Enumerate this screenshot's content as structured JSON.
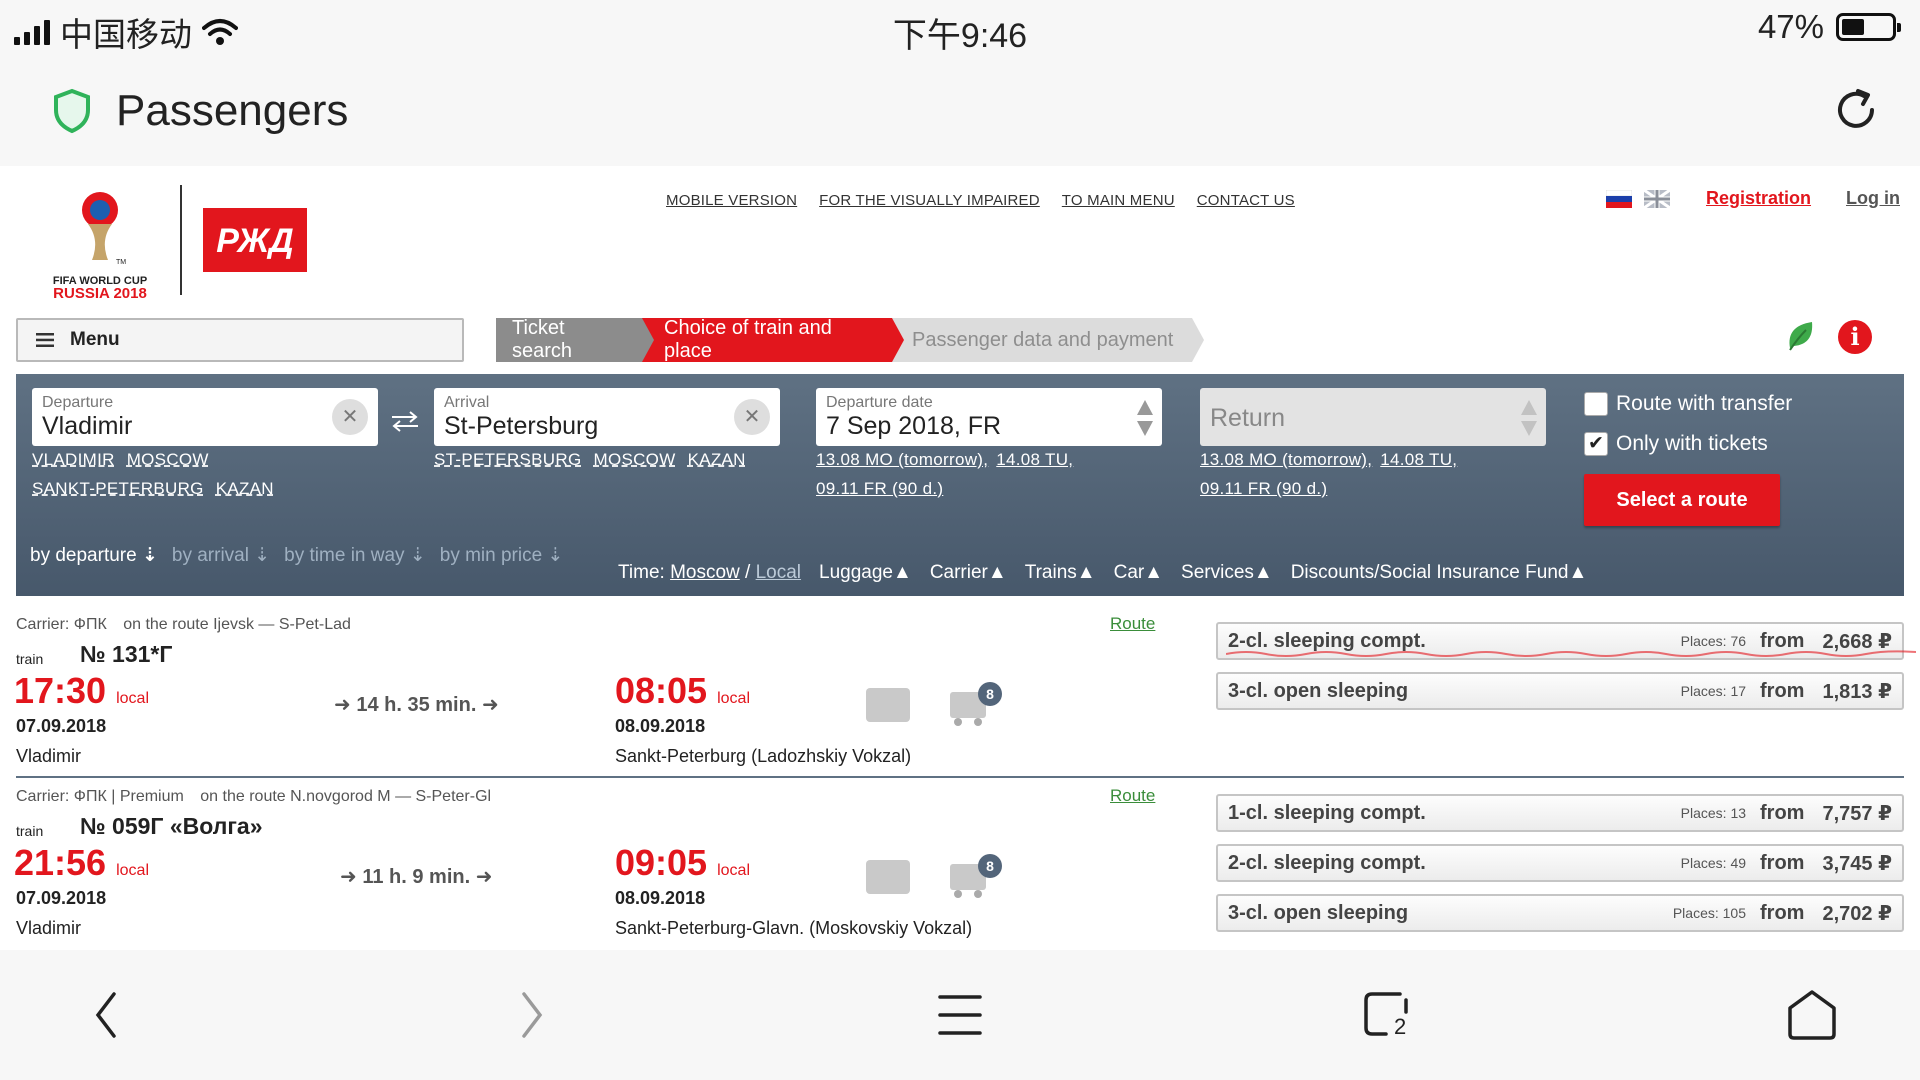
{
  "status_bar": {
    "carrier": "中国移动",
    "time": "下午9:46",
    "battery": "47%"
  },
  "app_header": {
    "title": "Passengers"
  },
  "site": {
    "top_links": [
      "MOBILE VERSION",
      "FOR THE VISUALLY IMPAIRED",
      "TO MAIN MENU",
      "CONTACT US"
    ],
    "registration": "Registration",
    "login": "Log in",
    "logo_text": {
      "line1": "FIFA WORLD CUP",
      "line2": "RUSSIA 2018",
      "tm": "TM",
      "rzd": "РЖД"
    }
  },
  "menu_label": "Menu",
  "steps": [
    "Ticket search",
    "Choice of train and place",
    "Passenger data and payment"
  ],
  "search": {
    "departure": {
      "label": "Departure",
      "value": "Vladimir",
      "suggestions": [
        "VLADIMIR",
        "MOSCOW",
        "SANKT-PETERBURG",
        "KAZAN"
      ]
    },
    "arrival": {
      "label": "Arrival",
      "value": "St-Petersburg",
      "suggestions": [
        "ST-PETERSBURG",
        "MOSCOW",
        "KAZAN"
      ]
    },
    "departure_date": {
      "label": "Departure date",
      "value": "7 Sep 2018, FR",
      "quick1": "13.08 MO (tomorrow),",
      "quick2": "14.08 TU,",
      "quick3": "09.11 FR (90 d.)"
    },
    "return": {
      "placeholder": "Return",
      "quick1": "13.08 MO (tomorrow),",
      "quick2": "14.08 TU,",
      "quick3": "09.11 FR (90 d.)"
    },
    "route_with_transfer": {
      "label": "Route with transfer",
      "checked": false
    },
    "only_with_tickets": {
      "label": "Only with tickets",
      "checked": true
    },
    "select_button": "Select a route"
  },
  "sorting": [
    "by departure",
    "by arrival",
    "by time in way",
    "by min price"
  ],
  "filters": {
    "time_label": "Time:",
    "time_moscow": "Moscow",
    "time_sep": "/",
    "time_local": "Local",
    "items": [
      "Luggage",
      "Carrier",
      "Trains",
      "Car",
      "Services",
      "Discounts/Social Insurance Fund"
    ]
  },
  "trains": [
    {
      "carrier": "Carrier: ФПК",
      "route_info": "on the route Ijevsk — S-Pet-Lad",
      "route_link": "Route",
      "train_label": "train",
      "number": "№ 131*Г",
      "dep_time": "17:30",
      "dep_suffix": "local",
      "dep_date": "07.09.2018",
      "dep_city": "Vladimir",
      "duration": "14 h. 35 min.",
      "arr_time": "08:05",
      "arr_suffix": "local",
      "arr_date": "08.09.2018",
      "arr_station": "Sankt-Peterburg (Ladozhskiy Vokzal)",
      "luggage_badge": "8",
      "seats": [
        {
          "name": "2-cl. sleeping compt.",
          "places": "Places: 76",
          "from": "from",
          "price": "2,668 ₽"
        },
        {
          "name": "3-cl. open sleeping",
          "places": "Places: 17",
          "from": "from",
          "price": "1,813 ₽"
        }
      ]
    },
    {
      "carrier": "Carrier: ФПК | Premium",
      "route_info": "on the route N.novgorod M — S-Peter-Gl",
      "route_link": "Route",
      "train_label": "train",
      "number": "№ 059Г «Волга»",
      "dep_time": "21:56",
      "dep_suffix": "local",
      "dep_date": "07.09.2018",
      "dep_city": "Vladimir",
      "duration": "11 h. 9 min.",
      "arr_time": "09:05",
      "arr_suffix": "local",
      "arr_date": "08.09.2018",
      "arr_station": "Sankt-Peterburg-Glavn. (Moskovskiy Vokzal)",
      "luggage_badge": "8",
      "seats": [
        {
          "name": "1-cl. sleeping compt.",
          "places": "Places: 13",
          "from": "from",
          "price": "7,757 ₽"
        },
        {
          "name": "2-cl. sleeping compt.",
          "places": "Places: 49",
          "from": "from",
          "price": "3,745 ₽"
        },
        {
          "name": "3-cl. open sleeping",
          "places": "Places: 105",
          "from": "from",
          "price": "2,702 ₽"
        }
      ]
    }
  ],
  "bottom_nav": {
    "tabs_count": "2"
  },
  "colors": {
    "accent": "#e2161d",
    "panel": "#53657a",
    "step_gray": "#8c8c8c"
  }
}
